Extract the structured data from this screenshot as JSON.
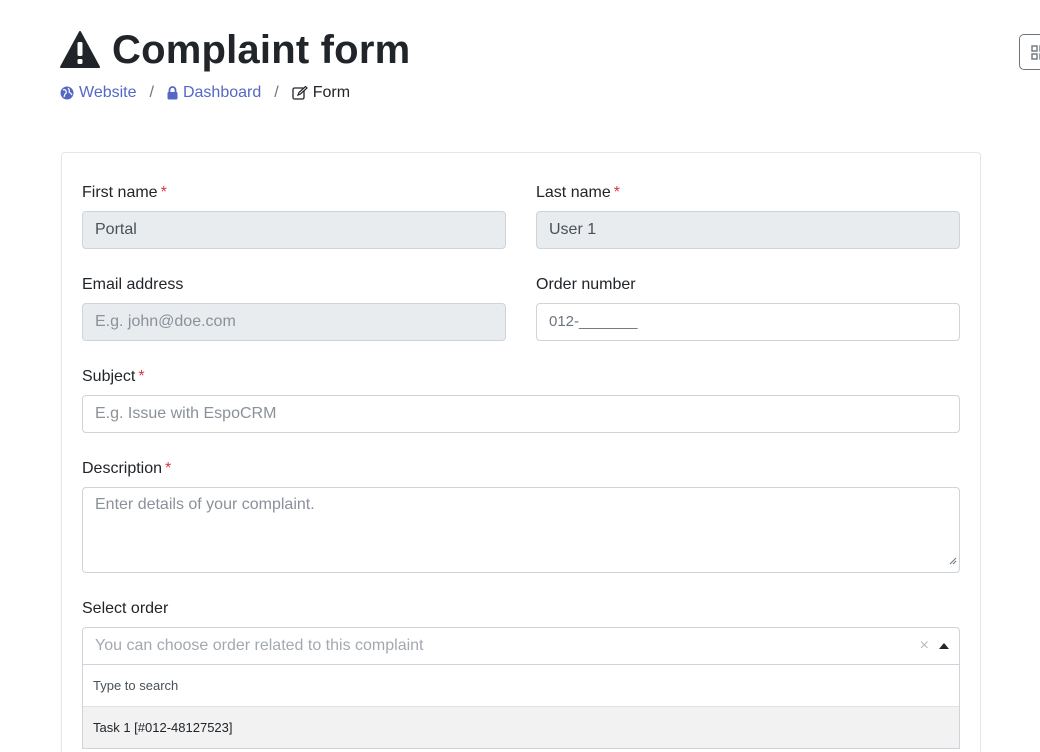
{
  "header": {
    "title": "Complaint form"
  },
  "breadcrumb": {
    "website": "Website",
    "dashboard": "Dashboard",
    "form": "Form",
    "separator": "/"
  },
  "form": {
    "first_name": {
      "label": "First name",
      "required_mark": "*",
      "value": "Portal"
    },
    "last_name": {
      "label": "Last name",
      "required_mark": "*",
      "value": "User 1"
    },
    "email": {
      "label": "Email address",
      "placeholder": "E.g. john@doe.com"
    },
    "order_number": {
      "label": "Order number",
      "value": "012-_______"
    },
    "subject": {
      "label": "Subject",
      "required_mark": "*",
      "placeholder": "E.g. Issue with EspoCRM"
    },
    "description": {
      "label": "Description",
      "required_mark": "*",
      "placeholder": "Enter details of your complaint."
    },
    "select_order": {
      "label": "Select order",
      "placeholder": "You can choose order related to this complaint",
      "clear_glyph": "×",
      "search_placeholder": "Type to search",
      "options": [
        "Task 1 [#012-48127523]"
      ]
    }
  },
  "colors": {
    "link": "#5567c4",
    "required": "#dc3545",
    "disabled_bg": "#e9ecef"
  },
  "icons": {
    "title": "warning-triangle-icon",
    "website": "globe-icon",
    "dashboard": "lock-icon",
    "form": "edit-icon",
    "corner_button": "grid-icon"
  }
}
